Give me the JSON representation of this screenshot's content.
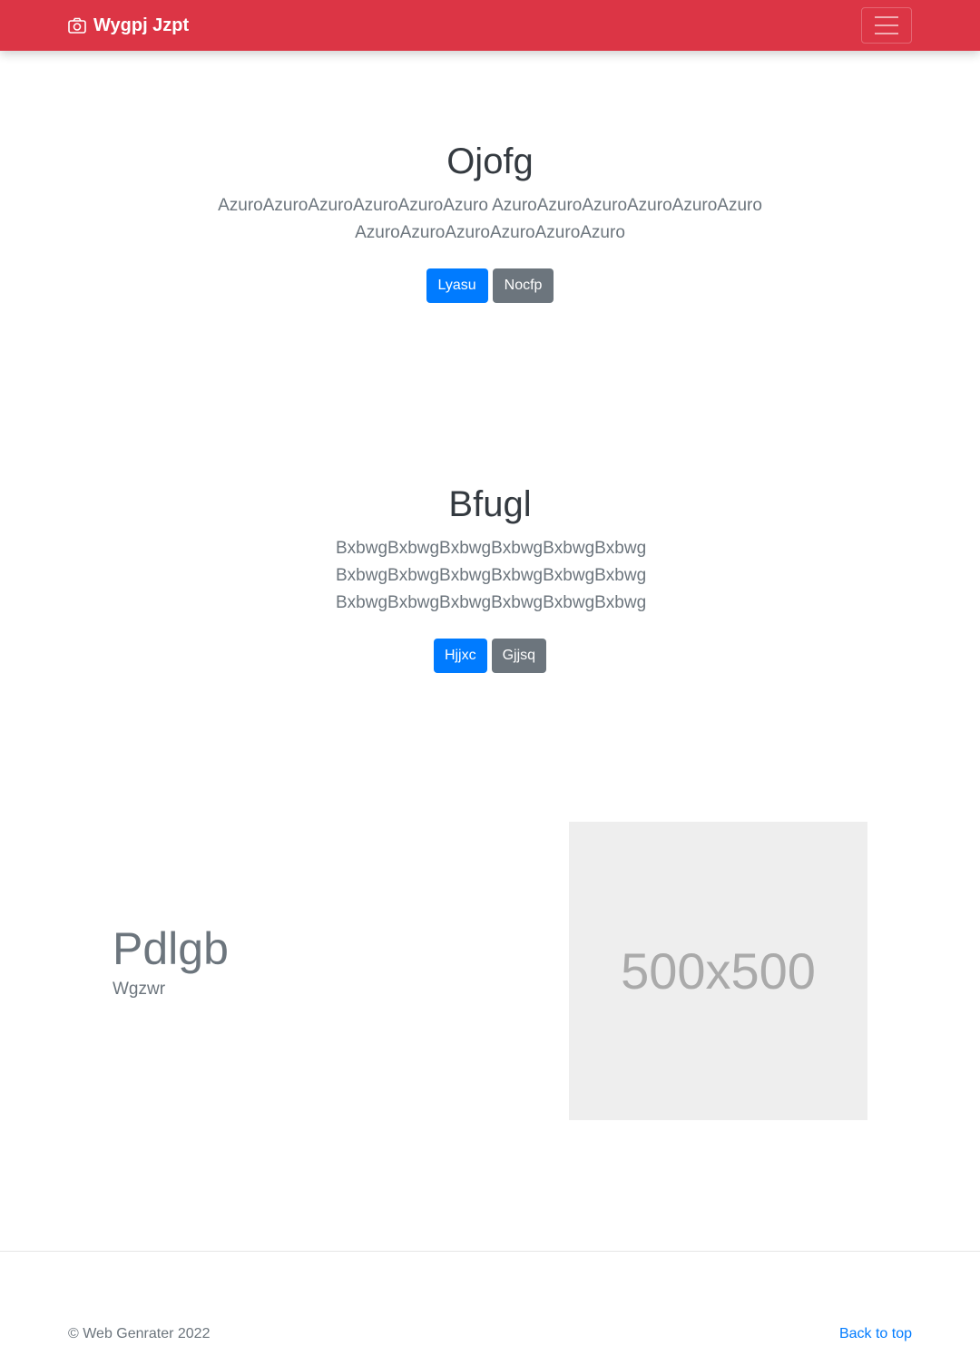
{
  "navbar": {
    "brand": "Wygpj Jzpt",
    "brand_icon": "camera-icon",
    "toggler_icon": "hamburger-menu-icon",
    "background": "#dc3545"
  },
  "hero1": {
    "title": "Ojofg",
    "text": "AzuroAzuroAzuroAzuroAzuroAzuro AzuroAzuroAzuroAzuroAzuroAzuro AzuroAzuroAzuroAzuroAzuroAzuro",
    "primary_button": "Lyasu",
    "secondary_button": "Nocfp"
  },
  "hero2": {
    "title": "Bfugl",
    "text": "BxbwgBxbwgBxbwgBxbwgBxbwgBxbwg BxbwgBxbwgBxbwgBxbwgBxbwgBxbwg BxbwgBxbwgBxbwgBxbwgBxbwgBxbwg",
    "primary_button": "Hjjxc",
    "secondary_button": "Gjjsq"
  },
  "feature": {
    "title": "Pdlgb",
    "subtitle": "Wgzwr",
    "image_label": "500x500"
  },
  "footer": {
    "copyright": "© Web Genrater 2022",
    "back_to_top": "Back to top"
  },
  "colors": {
    "primary": "#007bff",
    "secondary": "#6c757d",
    "danger": "#dc3545"
  }
}
